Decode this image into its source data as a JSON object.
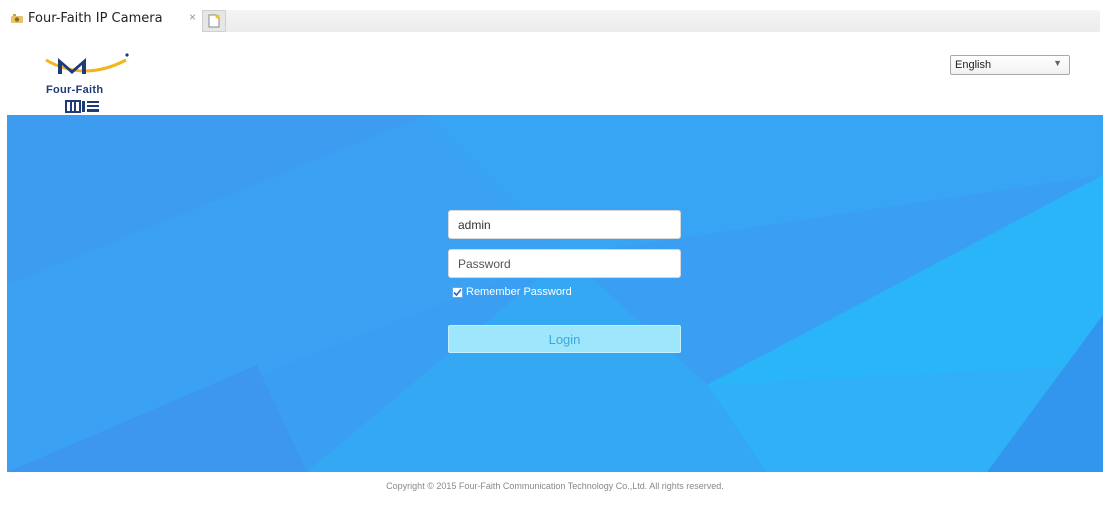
{
  "browser": {
    "tab_title": "Four-Faith IP Camera",
    "close_glyph": "×",
    "favicon_icon": "camera-favicon-icon",
    "new_tab_icon": "new-tab-icon"
  },
  "header": {
    "logo_text": "Four-Faith",
    "language": {
      "selected": "English",
      "arrow_glyph": "▼"
    }
  },
  "login": {
    "username_value": "admin",
    "password_placeholder": "Password",
    "remember_label": "Remember Password",
    "remember_checked": true,
    "login_label": "Login"
  },
  "footer": {
    "copyright": "Copyright © 2015 Four-Faith Communication Technology Co.,Ltd. All rights reserved."
  },
  "colors": {
    "banner_blue": "#3a9ff2",
    "login_button": "#9ee6fc",
    "logo_gold": "#f2b51c",
    "logo_navy": "#1f3a78"
  }
}
